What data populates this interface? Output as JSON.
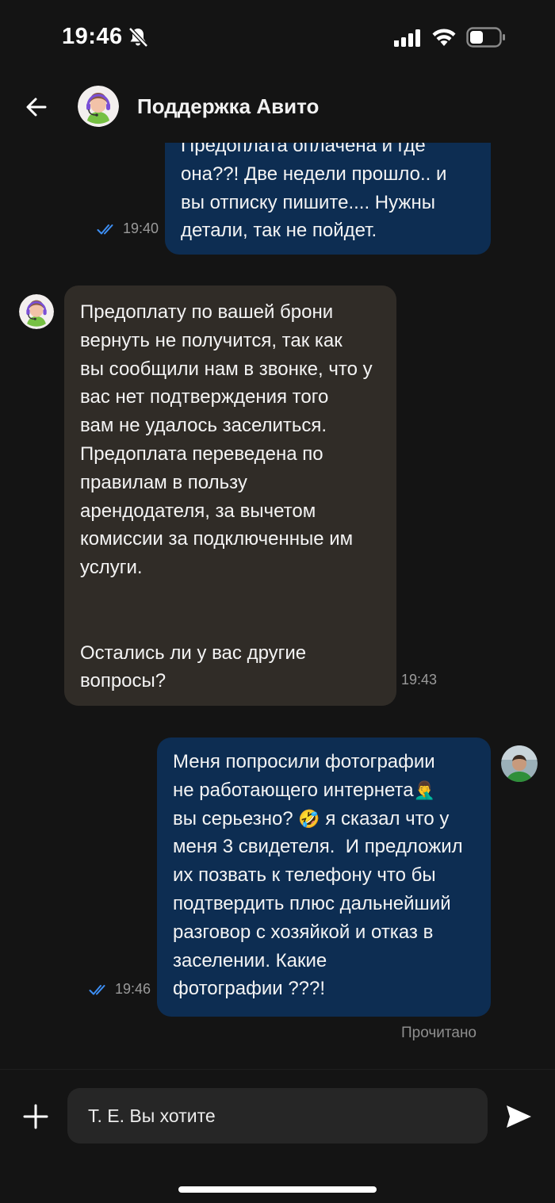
{
  "status_bar": {
    "time": "19:46",
    "icons": [
      "bell-slash-icon",
      "signal-icon",
      "wifi-icon",
      "battery-icon"
    ]
  },
  "header": {
    "title": "Поддержка Авито",
    "back_icon": "arrow-left-icon",
    "avatar": "support-agent-avatar"
  },
  "messages": [
    {
      "direction": "outgoing",
      "text": "Предоплата оплачена и где\nона??! Две недели прошло.. и\nвы отписку пишите.... Нужны\nдетали, так не пойдет.",
      "time": "19:40",
      "read": true
    },
    {
      "direction": "incoming",
      "text": "Предоплату по вашей брони\nвернуть не получится, так как\nвы сообщили нам в звонке, что у\nвас нет подтверждения того\nвам не удалось заселиться.\nПредоплата переведена по\nправилам в пользу\nарендодателя, за вычетом\nкомиссии за подключенные им\nуслуги.\n\n\nОстались ли у вас другие\nвопросы?",
      "time": "19:43"
    },
    {
      "direction": "outgoing",
      "text_line1": "Меня попросили фотографии",
      "text_line2": "не работающего интернета",
      "emoji1": "🤦‍♂️",
      "text_line3": "вы серьезно?",
      "emoji2": "🤣",
      "text_line3b": " я сказал что у",
      "text_rest": "меня 3 свидетеля.  И предложил\nих позвать к телефону что бы\nподтвердить плюс дальнейший\nразговор с хозяйкой и отказ в\nзаселении. Какие\nфотографии ???!",
      "time": "19:46",
      "read": true
    }
  ],
  "read_status": "Прочитано",
  "composer": {
    "input_value": "Т. Е. Вы хотите",
    "plus_icon": "plus-icon",
    "send_icon": "send-icon"
  },
  "colors": {
    "background": "#141414",
    "outgoing_bubble": "#0d2d52",
    "incoming_bubble": "#302c27",
    "read_check": "#3d8ff5"
  }
}
